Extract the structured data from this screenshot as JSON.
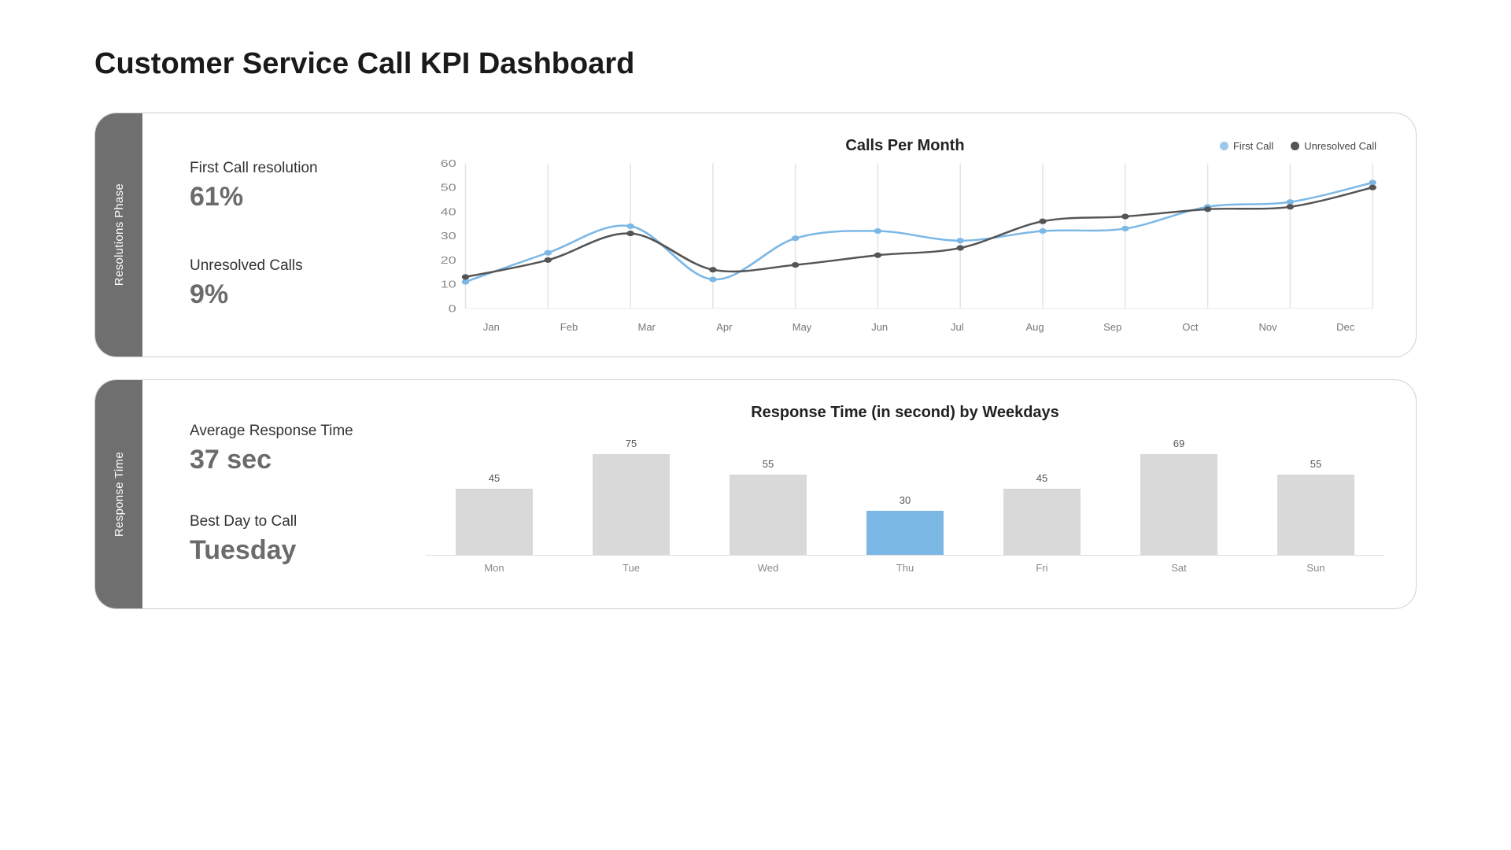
{
  "title": "Customer Service Call KPI Dashboard",
  "panel1": {
    "side_label": "Resolutions Phase",
    "metric1": {
      "label": "First Call resolution",
      "value": "61%"
    },
    "metric2": {
      "label": "Unresolved Calls",
      "value": "9%"
    },
    "chart_title": "Calls Per Month",
    "legend": {
      "first": "First Call",
      "unresolved": "Unresolved Call"
    }
  },
  "panel2": {
    "side_label": "Response Time",
    "metric1": {
      "label": "Average Response Time",
      "value": "37 sec"
    },
    "metric2": {
      "label": "Best Day to Call",
      "value": "Tuesday"
    },
    "chart_title": "Response Time (in second) by Weekdays"
  },
  "chart_data": [
    {
      "type": "line",
      "title": "Calls Per Month",
      "categories": [
        "Jan",
        "Feb",
        "Mar",
        "Apr",
        "May",
        "Jun",
        "Jul",
        "Aug",
        "Sep",
        "Oct",
        "Nov",
        "Dec"
      ],
      "series": [
        {
          "name": "First Call",
          "color": "#7cb8e6",
          "values": [
            11,
            23,
            34,
            12,
            29,
            32,
            28,
            32,
            33,
            42,
            44,
            52
          ]
        },
        {
          "name": "Unresolved Call",
          "color": "#555555",
          "values": [
            13,
            20,
            31,
            16,
            18,
            22,
            25,
            36,
            38,
            41,
            42,
            50
          ]
        }
      ],
      "ylim": [
        0,
        60
      ],
      "yticks": [
        0,
        10,
        20,
        30,
        40,
        50,
        60
      ]
    },
    {
      "type": "bar",
      "title": "Response Time (in second) by Weekdays",
      "categories": [
        "Mon",
        "Tue",
        "Wed",
        "Thu",
        "Fri",
        "Sat",
        "Sun"
      ],
      "values": [
        45,
        75,
        55,
        30,
        45,
        69,
        55
      ],
      "highlight_index": 3,
      "ylim": [
        0,
        80
      ]
    }
  ]
}
